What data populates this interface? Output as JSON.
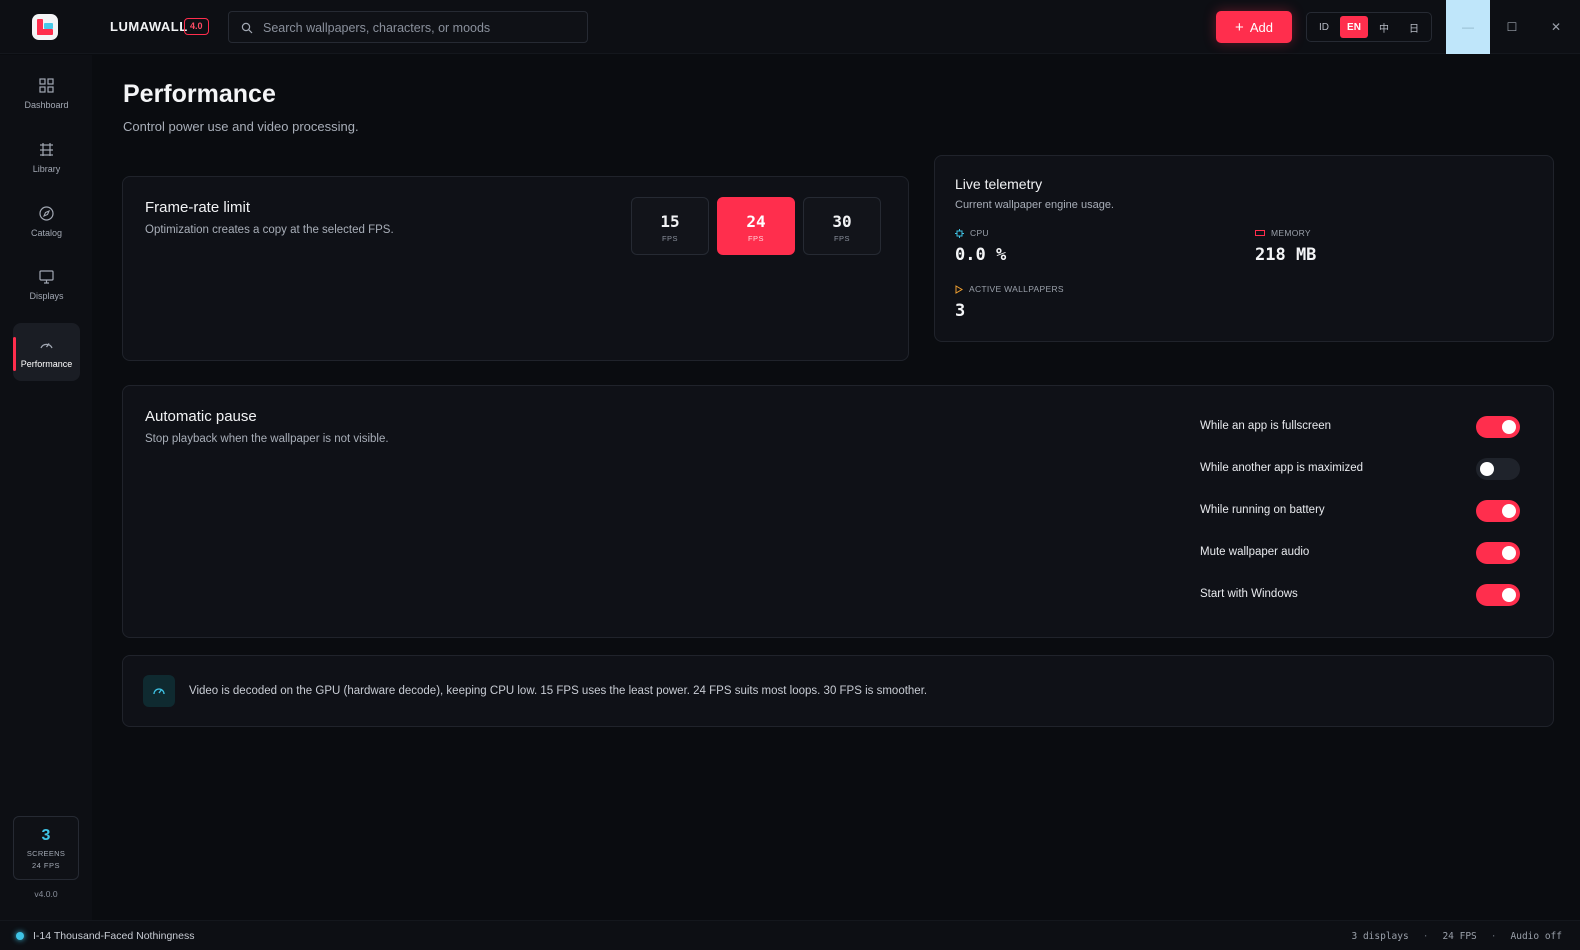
{
  "app": {
    "brand": "LUMAWALL",
    "version_badge": "4.0",
    "search_placeholder": "Search wallpapers, characters, or moods",
    "add_label": "Add",
    "languages": [
      {
        "code": "ID",
        "active": false
      },
      {
        "code": "EN",
        "active": true
      },
      {
        "code": "中",
        "active": false
      },
      {
        "code": "日",
        "active": false
      }
    ],
    "window_controls": {
      "minimize": "—",
      "maximize": "☐",
      "close": "✕"
    }
  },
  "sidebar": {
    "items": [
      {
        "label": "Dashboard",
        "icon": "grid-icon",
        "active": false
      },
      {
        "label": "Library",
        "icon": "library-icon",
        "active": false
      },
      {
        "label": "Catalog",
        "icon": "compass-icon",
        "active": false
      },
      {
        "label": "Displays",
        "icon": "monitor-icon",
        "active": false
      },
      {
        "label": "Performance",
        "icon": "gauge-icon",
        "active": true
      }
    ],
    "screens_count": "3",
    "screens_label": "SCREENS",
    "screens_fps": "24  FPS",
    "app_version": "v4.0.0"
  },
  "page": {
    "title": "Performance",
    "subtitle": "Control power use and video processing."
  },
  "frame_rate": {
    "title": "Frame-rate limit",
    "subtitle": "Optimization creates a copy at the selected FPS.",
    "unit": "FPS",
    "options": [
      {
        "value": "15",
        "selected": false
      },
      {
        "value": "24",
        "selected": true
      },
      {
        "value": "30",
        "selected": false
      }
    ]
  },
  "telemetry": {
    "title": "Live telemetry",
    "subtitle": "Current wallpaper engine usage.",
    "cpu_label": "CPU",
    "cpu_value": "0.0 %",
    "memory_label": "MEMORY",
    "memory_value": "218 MB",
    "active_label": "ACTIVE WALLPAPERS",
    "active_value": "3"
  },
  "auto_pause": {
    "title": "Automatic pause",
    "subtitle": "Stop playback when the wallpaper is not visible.",
    "toggles": [
      {
        "label": "While an app is fullscreen",
        "on": true
      },
      {
        "label": "While another app is maximized",
        "on": false
      },
      {
        "label": "While running on battery",
        "on": true
      },
      {
        "label": "Mute wallpaper audio",
        "on": true
      },
      {
        "label": "Start with Windows",
        "on": true
      }
    ]
  },
  "info": {
    "text": "Video is decoded on the GPU (hardware decode), keeping CPU low. 15 FPS uses the least power. 24 FPS suits most loops. 30 FPS is smoother."
  },
  "status": {
    "now_playing": "I-14 Thousand-Faced Nothingness",
    "displays": "3 displays",
    "fps": "24 FPS",
    "audio": "Audio off",
    "separator": "·"
  },
  "colors": {
    "accent": "#ff2e4d",
    "accent_cyan": "#3fc4e6",
    "background": "#0a0c10",
    "card": "#0f1117"
  }
}
